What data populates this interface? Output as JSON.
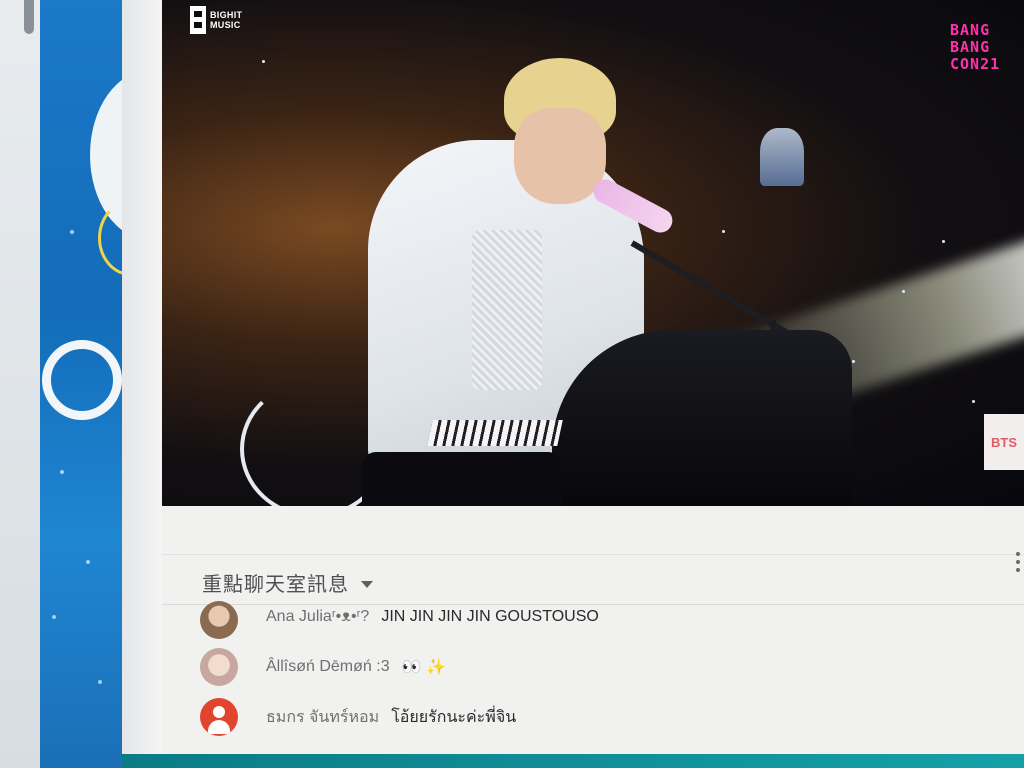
{
  "video": {
    "brand_logo": "BIGHIT MUSIC",
    "event_logo": "BANG BANG CON21",
    "corner_tag": "BTS"
  },
  "chat": {
    "title": "重點聊天室訊息",
    "more_menu_icon": "vertical-dots-icon",
    "messages": [
      {
        "author": "Ana Juliaʳ•ᴥ•ʳ?",
        "text": "JIN JIN JIN JIN GOUSTOUSO"
      },
      {
        "author": "Âllîsøń Dēmøń :3",
        "text": "👀 ✨"
      },
      {
        "author": "ธมกร จันทร์หอม",
        "text": "โอ้ยยรักนะค่ะพี่จิน"
      }
    ]
  },
  "colors": {
    "event_logo": "#ff2fae",
    "wallpaper_blue": "#1b79c8",
    "default_avatar": "#e2452e"
  }
}
